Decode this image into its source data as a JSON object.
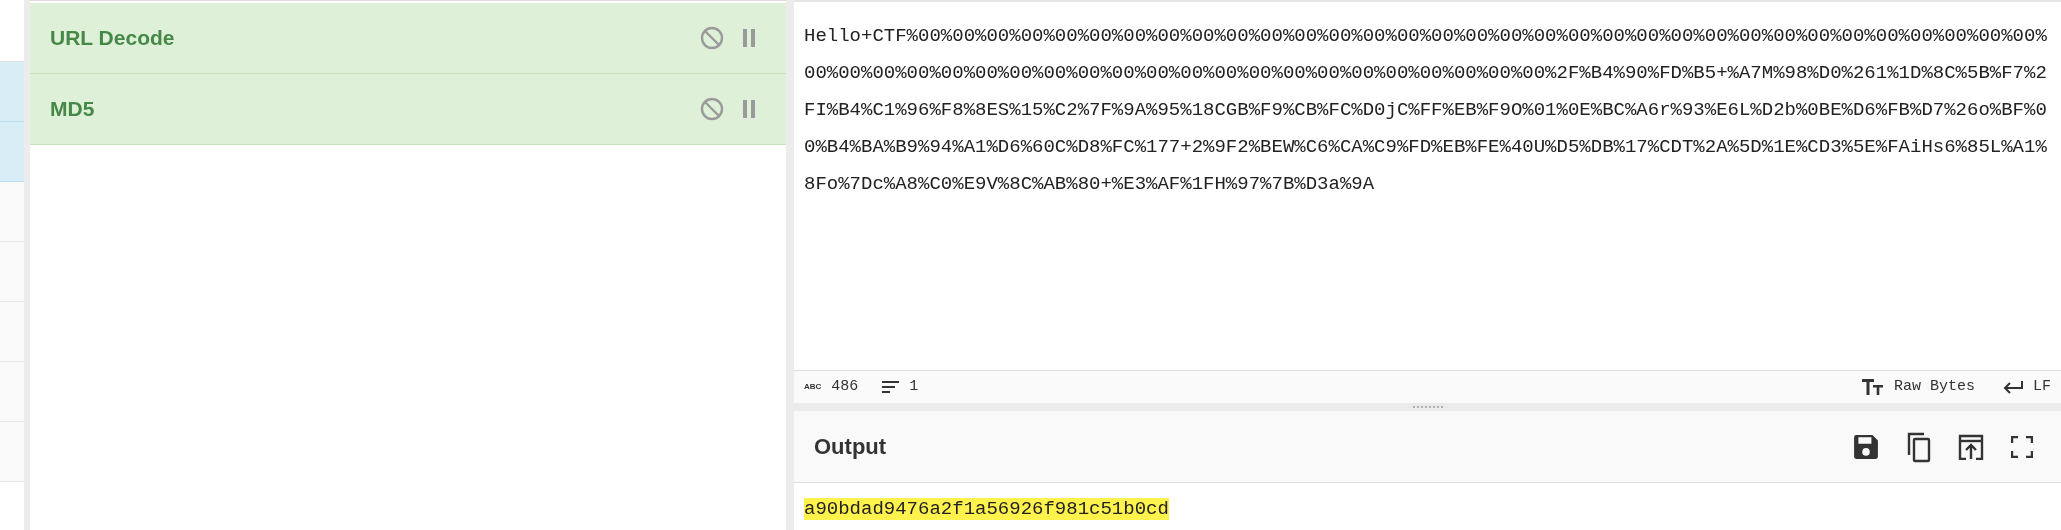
{
  "operation_list": {
    "rows": [
      {
        "kind": "plain"
      },
      {
        "kind": "highlighted"
      },
      {
        "kind": "highlighted"
      },
      {
        "kind": "muted"
      },
      {
        "kind": "muted"
      },
      {
        "kind": "muted"
      },
      {
        "kind": "muted"
      },
      {
        "kind": "muted"
      }
    ]
  },
  "recipe": [
    {
      "name": "URL Decode"
    },
    {
      "name": "MD5"
    }
  ],
  "input": {
    "lines": [
      "Hello+CTF%00%00%00%00%00%00%00%00%00%00%00%00%00%00%00%00%00%00%00%00%00%00%00%00%00%00%00%00%00%00%00%00%00%",
      "00%00%00%00%00%00%00%00%00%00%00%00%00%00%00%00%00%00%00%00%00%00%2F%B4%90%FD%B5+%A7M%98%D0%261%1D%8C%5B%F7%2",
      "FI%B4%C1%96%F8%8ES%15%C2%7F%9A%95%18CGB%F9%CB%FC%D0jC%FF%EB%F9O%01%0E%BC%A6r%93%E6L%D2b%0BE%D6%FB%D7%26o%BF%0",
      "0%B4%BA%B9%94%A1%D6%60C%D8%FC%177+2%9F2%BEW%C6%CA%C9%FD%EB%FE%40U%D5%DB%17%CDT%2A%5D%1E%CD3%5E%FAiHs6%85L%A1%",
      "8Fo%7Dc%A8%C0%E9V%8C%AB%80+%E3%AF%1FH%97%7B%D3a%9A"
    ],
    "status_bar": {
      "length_label": "ABC",
      "length": "486",
      "lines": "1",
      "encoding": "Raw Bytes",
      "eol": "LF"
    }
  },
  "output": {
    "title": "Output",
    "value": "a90bdad9476a2f1a56926f981c51b0cd"
  }
}
